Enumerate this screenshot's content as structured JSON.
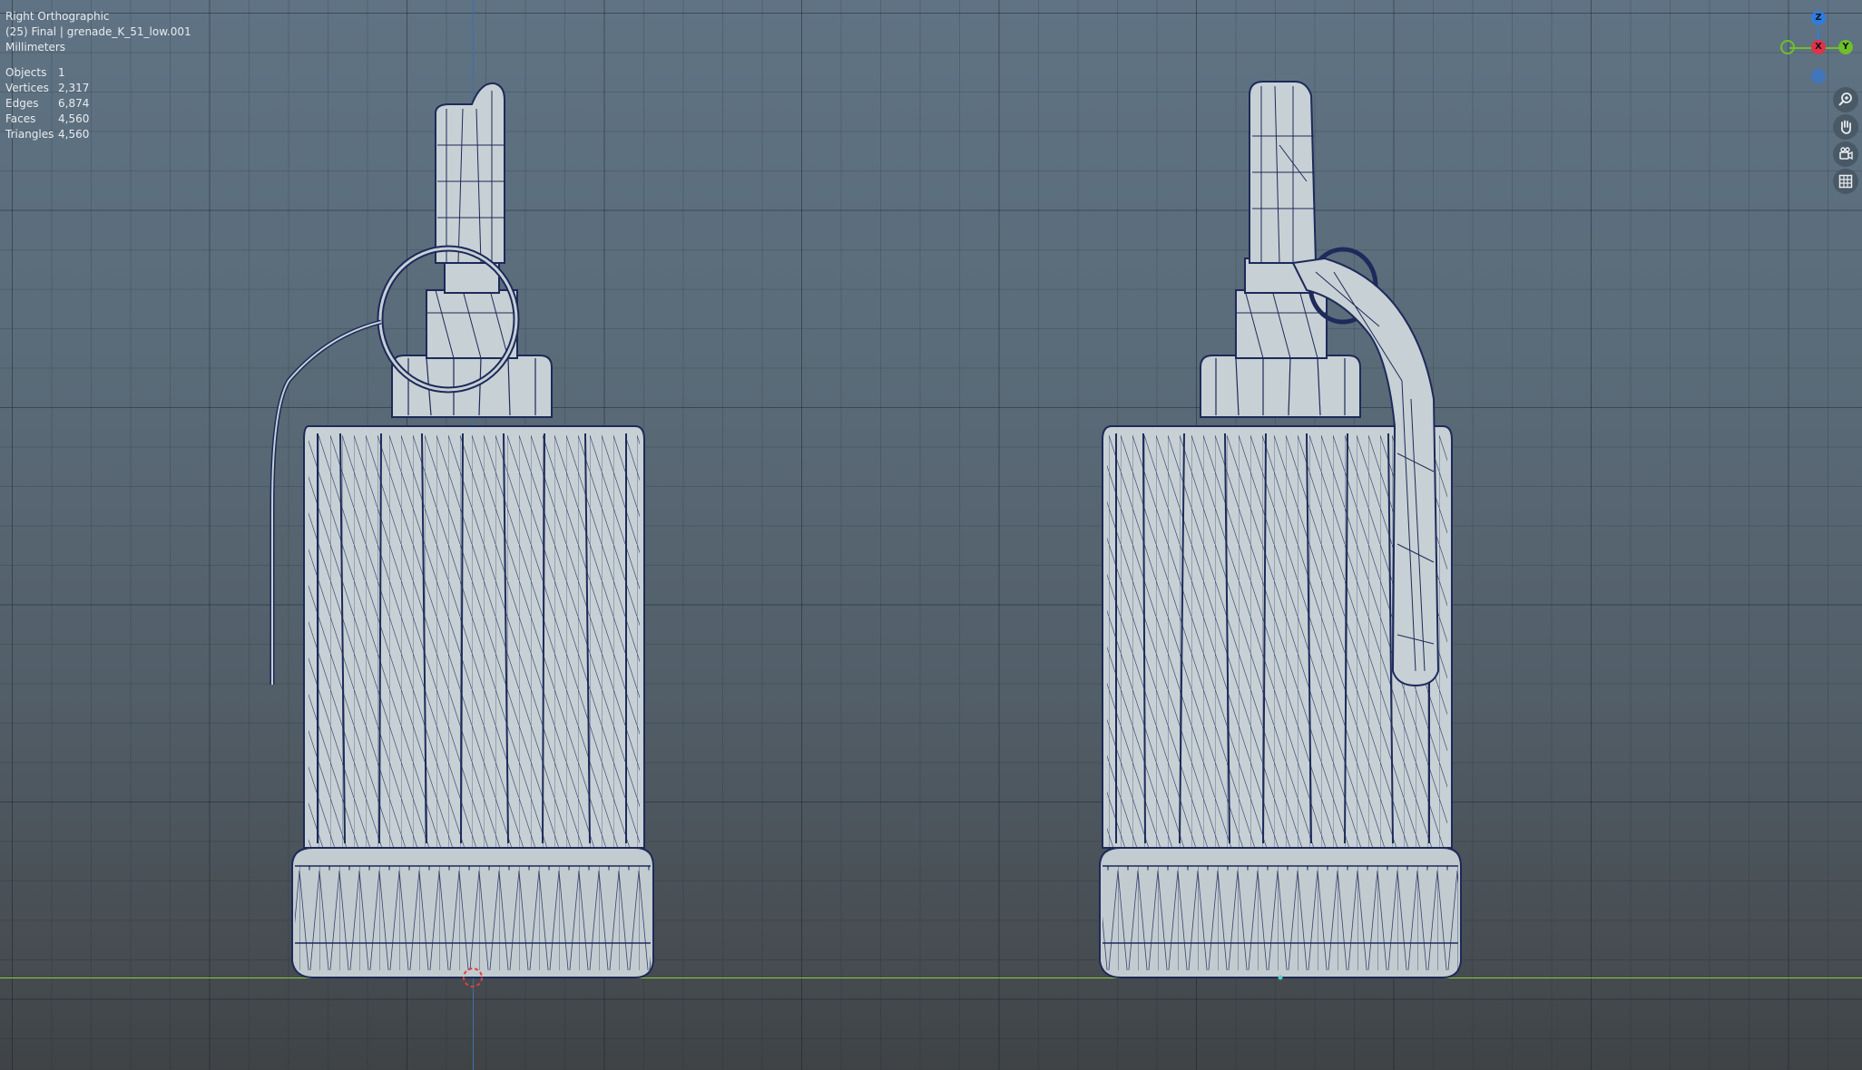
{
  "viewport": {
    "view_name": "Right Orthographic",
    "collection_line": "(25) Final | grenade_K_51_low.001",
    "units": "Millimeters",
    "stats": [
      {
        "key": "Objects",
        "value": "1"
      },
      {
        "key": "Vertices",
        "value": "2,317"
      },
      {
        "key": "Edges",
        "value": "6,874"
      },
      {
        "key": "Faces",
        "value": "4,560"
      },
      {
        "key": "Triangles",
        "value": "4,560"
      }
    ]
  },
  "gizmo": {
    "z_label": "Z",
    "x_label": "X",
    "y_label": "Y",
    "colors": {
      "z": "#2f7ce0",
      "x": "#e0334a",
      "y": "#6fbf2a"
    }
  },
  "nav_tools": [
    {
      "icon": "zoom-icon"
    },
    {
      "icon": "pan-hand-icon"
    },
    {
      "icon": "camera-view-icon"
    },
    {
      "icon": "grid-ortho-icon"
    }
  ],
  "colors": {
    "mesh_fill": "#c7d0d4",
    "wire": "#1d2a5a",
    "axis_z": "#3f6fa8",
    "axis_y": "#8ccd3a"
  }
}
